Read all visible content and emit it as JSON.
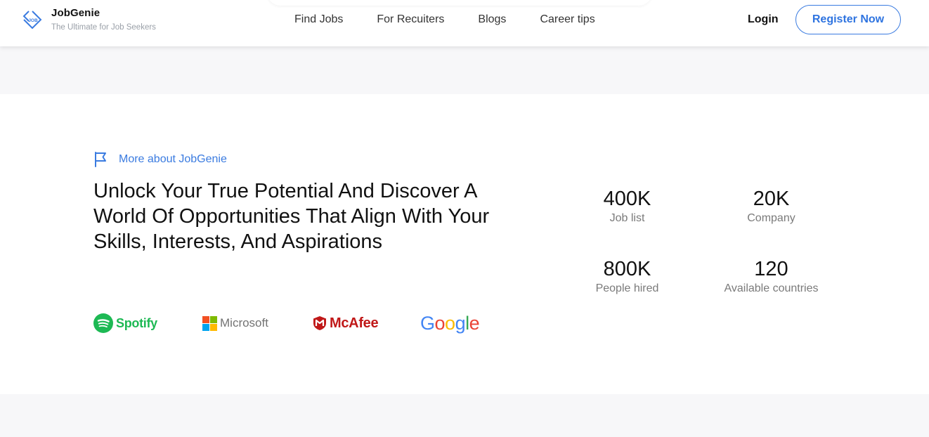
{
  "brand": {
    "name": "JobGenie",
    "tagline": "The Ultimate for Job Seekers",
    "logo_text": "JOB"
  },
  "nav": {
    "items": [
      "Find Jobs",
      "For Recuiters",
      "Blogs",
      "Career tips"
    ]
  },
  "auth": {
    "login_label": "Login",
    "register_label": "Register Now"
  },
  "about": {
    "link_label": "More about JobGenie",
    "headline": "Unlock Your True Potential And Discover A World Of Opportunities That Align With Your Skills, Interests, And Aspirations"
  },
  "partners": {
    "spotify": "Spotify",
    "microsoft": "Microsoft",
    "mcafee": "McAfee",
    "google": "Google"
  },
  "stats": [
    {
      "value": "400K",
      "label": "Job list"
    },
    {
      "value": "20K",
      "label": "Company"
    },
    {
      "value": "800K",
      "label": "People hired"
    },
    {
      "value": "120",
      "label": "Available countries"
    }
  ],
  "colors": {
    "accent": "#2f74e0",
    "spotify": "#1db954",
    "mcafee": "#c01818",
    "page_bg": "#f7f7f9"
  }
}
